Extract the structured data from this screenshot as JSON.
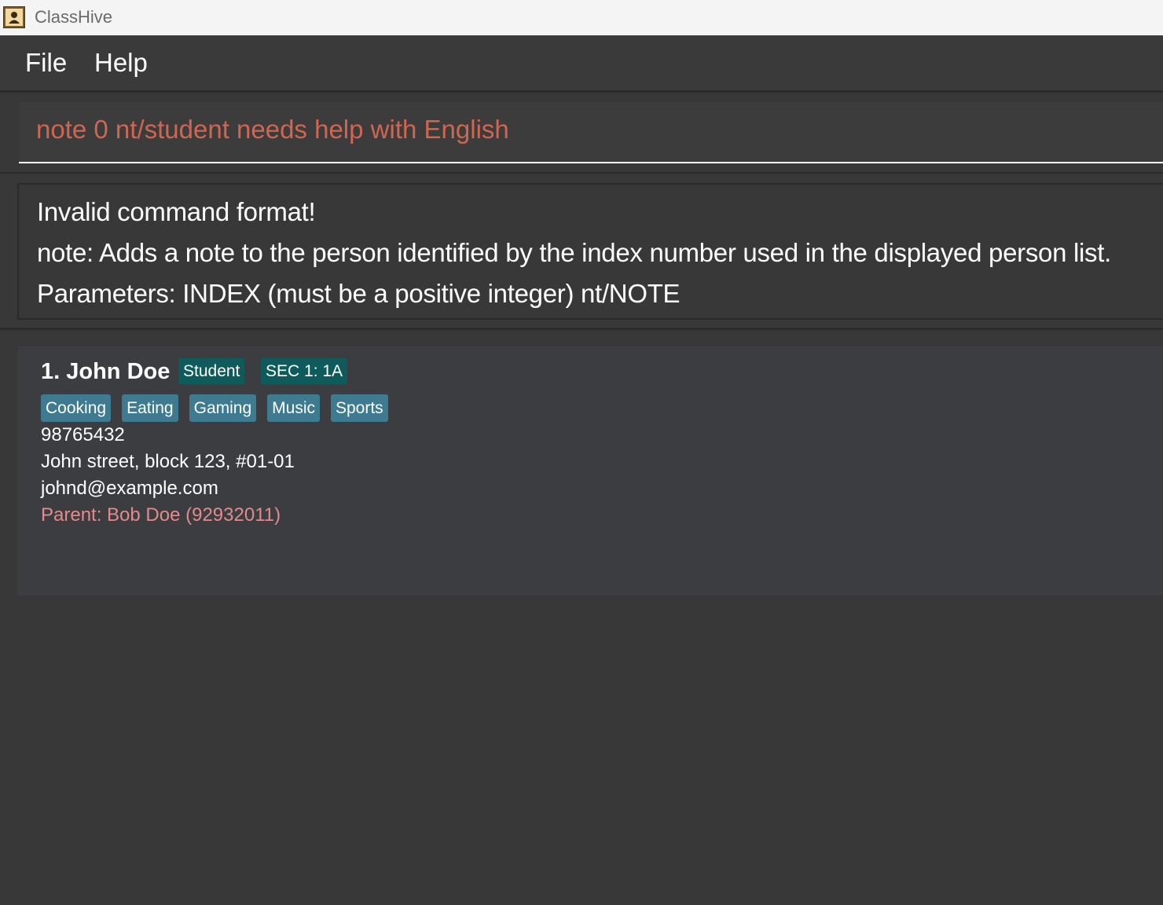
{
  "window": {
    "title": "ClassHive",
    "icon": "address-book-icon"
  },
  "menu": {
    "file_label": "File",
    "help_label": "Help"
  },
  "command": {
    "value": "note 0 nt/student needs help with English",
    "text_color": "#d06651"
  },
  "result": {
    "lines": [
      "Invalid command format!",
      "note: Adds a note to the person identified by the index number used in the displayed person list.",
      "Parameters: INDEX (must be a positive integer) nt/NOTE"
    ]
  },
  "persons": [
    {
      "name": "1. John Doe",
      "roles": [
        "Student",
        "SEC 1: 1A"
      ],
      "tags": [
        "Cooking",
        "Eating",
        "Gaming",
        "Music",
        "Sports"
      ],
      "phone": "98765432",
      "address": "John street, block 123, #01-01",
      "email": "johnd@example.com",
      "parent": "Parent: Bob Doe (92932011)"
    }
  ],
  "colors": {
    "background": "#383838",
    "role_badge": "#0f5b5b",
    "tag": "#3e7b91",
    "parent_text": "#e38a8e"
  }
}
